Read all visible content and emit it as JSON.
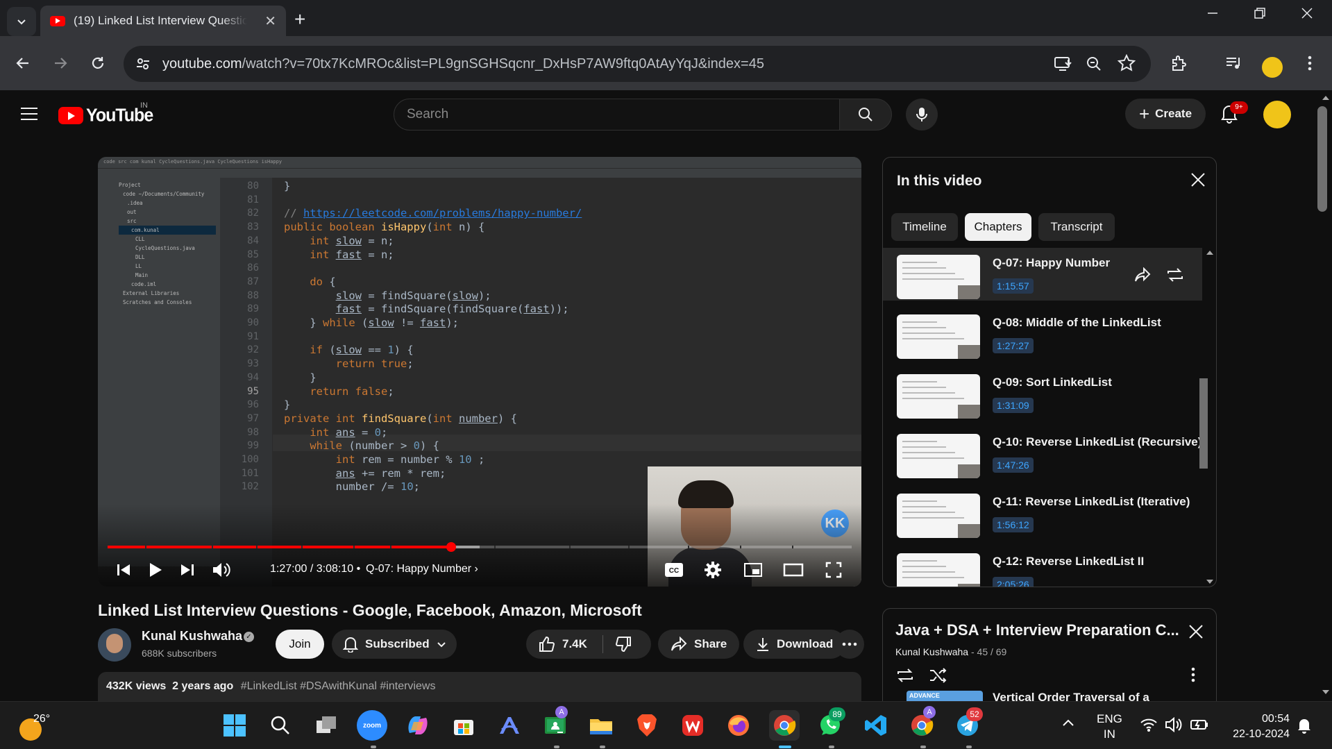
{
  "browser": {
    "tab_title": "(19) Linked List Interview Questions - Google, Facebook, Amazon, Microsoft",
    "url_domain": "youtube.com",
    "url_path": "/watch?v=70tx7KcMROc&list=PL9gnSGHSqcnr_DxHsP7AW9ftq0AtAyYqJ&index=45"
  },
  "yt_header": {
    "logo_text": "YouTube",
    "region": "IN",
    "search_placeholder": "Search",
    "create_label": "Create",
    "notification_count": "9+"
  },
  "player": {
    "ide_breadcrumb": "code  src  com  kunal  CycleQuestions.java  CycleQuestions  isHappy",
    "ide_project_tree": [
      "Project",
      "code  ~/Documents/Community",
      ".idea",
      "out",
      "src",
      "com.kunal",
      "CLL",
      "CycleQuestions.java",
      "DLL",
      "LL",
      "Main",
      "code.iml",
      "External Libraries",
      "Scratches and Consoles"
    ],
    "current_time": "1:27:00",
    "duration": "3:08:10",
    "current_chapter": "Q-07: Happy Number",
    "progress_fraction": 0.462,
    "buffered_fraction": 0.5,
    "webcam_logo": "KK"
  },
  "code_lines": [
    {
      "n": "80",
      "html": "}"
    },
    {
      "n": "81",
      "html": ""
    },
    {
      "n": "82",
      "html": "<span class='c'>// </span><span class='l'>https://leetcode.com/problems/happy-number/</span>"
    },
    {
      "n": "83",
      "html": "<span class='k'>public boolean </span><span class='f'>isHappy</span>(<span class='k'>int </span>n) {"
    },
    {
      "n": "84",
      "html": "    <span class='k'>int </span><span class='u'>slow</span> = n;"
    },
    {
      "n": "85",
      "html": "    <span class='k'>int </span><span class='u'>fast</span> = n;"
    },
    {
      "n": "86",
      "html": ""
    },
    {
      "n": "87",
      "html": "    <span class='k'>do </span>{"
    },
    {
      "n": "88",
      "html": "        <span class='u'>slow</span> = findSquare(<span class='u'>slow</span>);"
    },
    {
      "n": "89",
      "html": "        <span class='u'>fast</span> = findSquare(findSquare(<span class='u'>fast</span>));"
    },
    {
      "n": "90",
      "html": "    } <span class='k'>while </span>(<span class='u'>slow</span> != <span class='u'>fast</span>);"
    },
    {
      "n": "91",
      "html": ""
    },
    {
      "n": "92",
      "html": "    <span class='k'>if </span>(<span class='u'>slow</span> == <span class='n'>1</span>) {"
    },
    {
      "n": "93",
      "html": "        <span class='k'>return true</span>;"
    },
    {
      "n": "94",
      "html": "    }"
    },
    {
      "n": "95",
      "html": "    <span class='k'>return false</span>;"
    },
    {
      "n": "96",
      "html": "}"
    },
    {
      "n": "97",
      "html": "<span class='k'>private int </span><span class='f'>findSquare</span>(<span class='k'>int </span><span class='u'>number</span>) {"
    },
    {
      "n": "98",
      "html": "    <span class='k'>int </span><span class='u'>ans</span> = <span class='n'>0</span>;"
    },
    {
      "n": "99",
      "html": "    <span class='k'>while </span>(number &gt; <span class='n'>0</span>) {"
    },
    {
      "n": "100",
      "html": "        <span class='k'>int </span>rem = number % <span class='n'>10</span> ;"
    },
    {
      "n": "101",
      "html": "        <span class='u'>ans</span> += rem * rem;"
    },
    {
      "n": "102",
      "html": "        number /= <span class='n'>10</span>;"
    }
  ],
  "video": {
    "title": "Linked List Interview Questions - Google, Facebook, Amazon, Microsoft",
    "channel_name": "Kunal Kushwaha",
    "subscribers": "688K subscribers",
    "join_label": "Join",
    "subscribed_label": "Subscribed",
    "likes": "7.4K",
    "share_label": "Share",
    "download_label": "Download",
    "views": "432K views",
    "age": "2 years ago",
    "hashtags": "#LinkedList #DSAwithKunal #interviews"
  },
  "chapters_panel": {
    "header": "In this video",
    "tabs": [
      "Timeline",
      "Chapters",
      "Transcript"
    ],
    "active_tab": "Chapters",
    "chapters": [
      {
        "title": "Q-07: Happy Number",
        "time": "1:15:57"
      },
      {
        "title": "Q-08: Middle of the LinkedList",
        "time": "1:27:27"
      },
      {
        "title": "Q-09: Sort LinkedList",
        "time": "1:31:09"
      },
      {
        "title": "Q-10: Reverse LinkedList (Recursive)",
        "time": "1:47:26"
      },
      {
        "title": "Q-11: Reverse LinkedList (Iterative)",
        "time": "1:56:12"
      },
      {
        "title": "Q-12: Reverse LinkedList II",
        "time": "2:05:26"
      }
    ]
  },
  "playlist_panel": {
    "title": "Java + DSA + Interview Preparation C...",
    "owner": "Kunal Kushwaha",
    "position": "45 / 69",
    "next_video_title": "Vertical Order Traversal of a",
    "next_thumb_label": "ADVANCE"
  },
  "taskbar": {
    "temperature": "26°",
    "whatsapp_badge": "89",
    "telegram_badge": "52",
    "language": "ENG",
    "region": "IN",
    "time": "00:54",
    "date": "22-10-2024"
  }
}
